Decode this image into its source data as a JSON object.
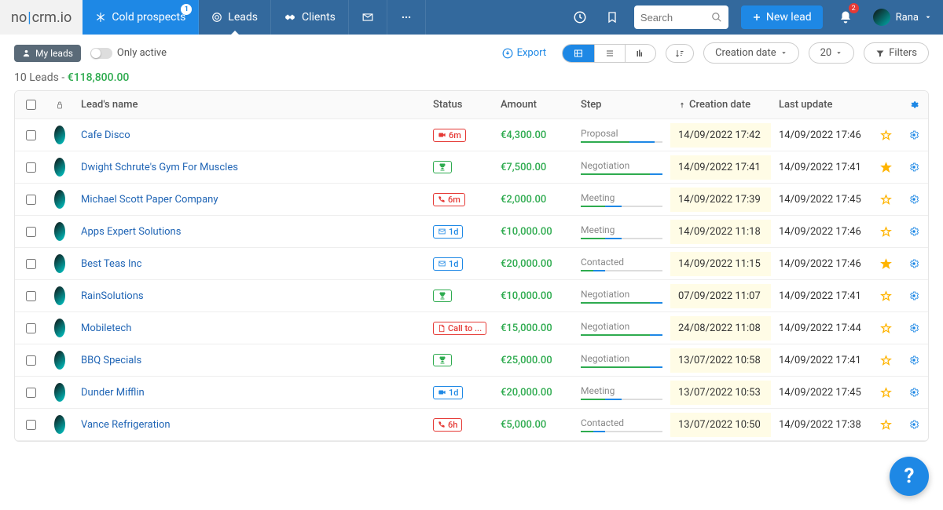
{
  "brand": {
    "part1": "no",
    "part2": "crm",
    "part3": ".io"
  },
  "nav": {
    "cold": {
      "label": "Cold prospects",
      "badge": "1"
    },
    "leads": {
      "label": "Leads"
    },
    "clients": {
      "label": "Clients"
    }
  },
  "search": {
    "placeholder": "Search"
  },
  "newlead": {
    "label": "New lead"
  },
  "notif": {
    "count": "2"
  },
  "user": {
    "name": "Rana"
  },
  "subbar": {
    "myleads": "My leads",
    "onlyactive": "Only active",
    "export": "Export",
    "sort": "Creation date",
    "pagesize": "20",
    "filters": "Filters"
  },
  "summary": {
    "count": "10 Leads - ",
    "amount": "€118,800.00"
  },
  "columns": {
    "name": "Lead's name",
    "status": "Status",
    "amount": "Amount",
    "step": "Step",
    "created": "Creation date",
    "updated": "Last update"
  },
  "status": {
    "video6m": {
      "icon": "video",
      "text": "6m",
      "tone": "red"
    },
    "trophy": {
      "icon": "trophy",
      "text": "",
      "tone": "green"
    },
    "phone6m": {
      "icon": "phone",
      "text": "6m",
      "tone": "red"
    },
    "mail1d": {
      "icon": "mail",
      "text": "1d",
      "tone": "blue"
    },
    "doc_call": {
      "icon": "doc",
      "text": "Call to ...",
      "tone": "red"
    },
    "video1d": {
      "icon": "video",
      "text": "1d",
      "tone": "blue"
    },
    "phone6h": {
      "icon": "phone",
      "text": "6h",
      "tone": "red"
    }
  },
  "leads": [
    {
      "name": "Cafe Disco",
      "status": "video6m",
      "amount": "€4,300.00",
      "step": "Proposal",
      "done": 60,
      "cur": 30,
      "created": "14/09/2022 17:42",
      "updated": "14/09/2022 17:46",
      "star": false
    },
    {
      "name": "Dwight Schrute's Gym For Muscles",
      "status": "trophy",
      "amount": "€7,500.00",
      "step": "Negotiation",
      "done": 85,
      "cur": 15,
      "created": "14/09/2022 17:41",
      "updated": "14/09/2022 17:41",
      "star": true
    },
    {
      "name": "Michael Scott Paper Company",
      "status": "phone6m",
      "amount": "€2,000.00",
      "step": "Meeting",
      "done": 30,
      "cur": 20,
      "created": "14/09/2022 17:39",
      "updated": "14/09/2022 17:45",
      "star": false
    },
    {
      "name": "Apps Expert Solutions",
      "status": "mail1d",
      "amount": "€10,000.00",
      "step": "Meeting",
      "done": 30,
      "cur": 20,
      "created": "14/09/2022 11:18",
      "updated": "14/09/2022 17:46",
      "star": false
    },
    {
      "name": "Best Teas Inc",
      "status": "mail1d",
      "amount": "€20,000.00",
      "step": "Contacted",
      "done": 15,
      "cur": 15,
      "created": "14/09/2022 11:15",
      "updated": "14/09/2022 17:46",
      "star": true
    },
    {
      "name": "RainSolutions",
      "status": "trophy",
      "amount": "€10,000.00",
      "step": "Negotiation",
      "done": 85,
      "cur": 15,
      "created": "07/09/2022 11:07",
      "updated": "14/09/2022 17:41",
      "star": false
    },
    {
      "name": "Mobiletech",
      "status": "doc_call",
      "amount": "€15,000.00",
      "step": "Negotiation",
      "done": 85,
      "cur": 15,
      "created": "24/08/2022 11:08",
      "updated": "14/09/2022 17:44",
      "star": false
    },
    {
      "name": "BBQ Specials",
      "status": "trophy",
      "amount": "€25,000.00",
      "step": "Negotiation",
      "done": 85,
      "cur": 15,
      "created": "13/07/2022 10:58",
      "updated": "14/09/2022 17:41",
      "star": false
    },
    {
      "name": "Dunder Mifflin",
      "status": "video1d",
      "amount": "€20,000.00",
      "step": "Meeting",
      "done": 30,
      "cur": 20,
      "created": "13/07/2022 10:53",
      "updated": "14/09/2022 17:45",
      "star": false
    },
    {
      "name": "Vance Refrigeration",
      "status": "phone6h",
      "amount": "€5,000.00",
      "step": "Contacted",
      "done": 15,
      "cur": 15,
      "created": "13/07/2022 10:50",
      "updated": "14/09/2022 17:38",
      "star": false
    }
  ],
  "help": "?"
}
